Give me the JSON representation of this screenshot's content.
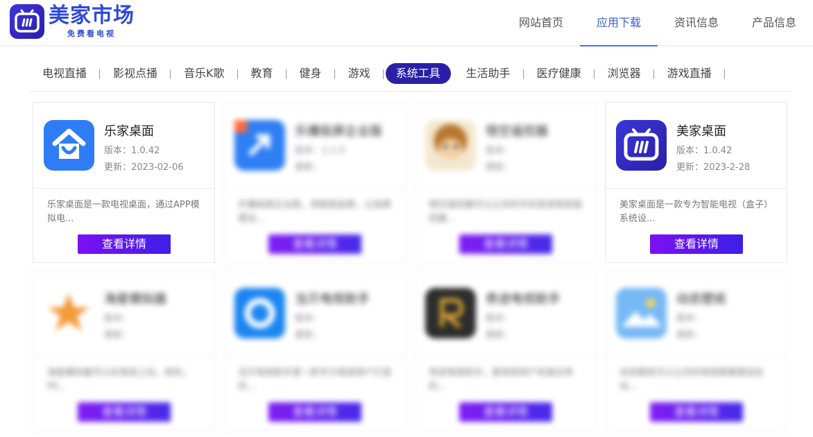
{
  "header": {
    "logo_title": "美家市场",
    "logo_subtitle": "免费看电视",
    "nav": [
      "网站首页",
      "应用下载",
      "资讯信息",
      "产品信息"
    ],
    "active_nav": 1
  },
  "categories": [
    "电视直播",
    "影视点播",
    "音乐K歌",
    "教育",
    "健身",
    "游戏",
    "系统工具",
    "生活助手",
    "医疗健康",
    "浏览器",
    "游戏直播"
  ],
  "active_category": 6,
  "cards": [
    {
      "name": "乐家桌面",
      "version": "版本：1.0.42",
      "date": "更新：2023-02-06",
      "desc": "乐家桌面是一款电视桌面，通过APP模拟电...",
      "button": "查看详情",
      "blurred": false,
      "icon": "home-smile-icon"
    },
    {
      "name": "乐播投屏企业版",
      "version": "版本：2.1.0",
      "date": "更新：",
      "desc": "乐播投屏企业版，用智能投屏，让投屏更加...",
      "button": "查看详情",
      "blurred": true,
      "icon": "cast-icon"
    },
    {
      "name": "悟空遥控器",
      "version": "版本：",
      "date": "更新：",
      "desc": "悟空遥控器可以让你的手机变成电视遥控器...",
      "button": "查看详情",
      "blurred": true,
      "icon": "monkey-icon"
    },
    {
      "name": "美家桌面",
      "version": "版本：1.0.42",
      "date": "更新：2023-2-28",
      "desc": "美家桌面是一款专为智能电视（盒子）系统设...",
      "button": "查看详情",
      "blurred": false,
      "icon": "tv-icon"
    },
    {
      "name": "海星模拟器",
      "version": "版本：",
      "date": "更新：",
      "desc": "海星模拟器可以在电视上玩，街机，PS...",
      "button": "查看详情",
      "blurred": true,
      "icon": "star-icon"
    },
    {
      "name": "当贝电视助手",
      "version": "版本：",
      "date": "更新：",
      "desc": "当贝电视助手是一款专为电视用户打造的...",
      "button": "查看详情",
      "blurred": true,
      "icon": "circle-icon"
    },
    {
      "name": "奇迹电视助手",
      "version": "版本：",
      "date": "更新：",
      "desc": "奇迹电视助手，是电视用户安装应用的...",
      "button": "查看详情",
      "blurred": true,
      "icon": "r-letter-icon"
    },
    {
      "name": "动态壁纸",
      "version": "版本：",
      "date": "更新：",
      "desc": "动态壁纸可以让你的电视屏幕更加生动...",
      "button": "查看详情",
      "blurred": true,
      "icon": "landscape-icon"
    }
  ]
}
